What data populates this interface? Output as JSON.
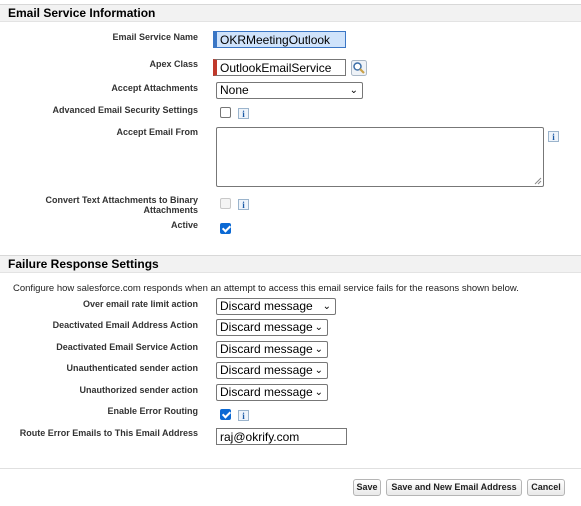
{
  "email_service": {
    "header": "Email Service Information",
    "fields": {
      "service_name": {
        "label": "Email Service Name",
        "value": "OKRMeetingOutlook"
      },
      "apex_class": {
        "label": "Apex Class",
        "value": "OutlookEmailService",
        "lookup_icon": "magnifier-lookup-icon"
      },
      "accept_attachments": {
        "label": "Accept Attachments",
        "value": "None"
      },
      "advanced_security": {
        "label": "Advanced Email Security Settings",
        "checked": false
      },
      "accept_email_from": {
        "label": "Accept Email From",
        "value": ""
      },
      "convert_attachments": {
        "label": "Convert Text Attachments to Binary Attachments",
        "checked": false,
        "disabled": true
      },
      "active": {
        "label": "Active",
        "checked": true
      }
    }
  },
  "failure_response": {
    "header": "Failure Response Settings",
    "description": "Configure how salesforce.com responds when an attempt to access this email service fails for the reasons shown below.",
    "fields": {
      "over_limit": {
        "label": "Over email rate limit action",
        "value": "Discard message"
      },
      "deactivated_address": {
        "label": "Deactivated Email Address Action",
        "value": "Discard message"
      },
      "deactivated_service": {
        "label": "Deactivated Email Service Action",
        "value": "Discard message"
      },
      "unauthenticated": {
        "label": "Unauthenticated sender action",
        "value": "Discard message"
      },
      "unauthorized": {
        "label": "Unauthorized sender action",
        "value": "Discard message"
      },
      "error_routing": {
        "label": "Enable Error Routing",
        "checked": true
      },
      "route_to": {
        "label": "Route Error Emails to This Email Address",
        "value": "raj@okrify.com"
      }
    }
  },
  "buttons": {
    "save": "Save",
    "save_new": "Save and New Email Address",
    "cancel": "Cancel"
  },
  "icons": {
    "info": "i",
    "chevron": "⌄"
  },
  "colors": {
    "required_bar": "#c0392b",
    "checkbox_checked": "#0b69d4"
  }
}
